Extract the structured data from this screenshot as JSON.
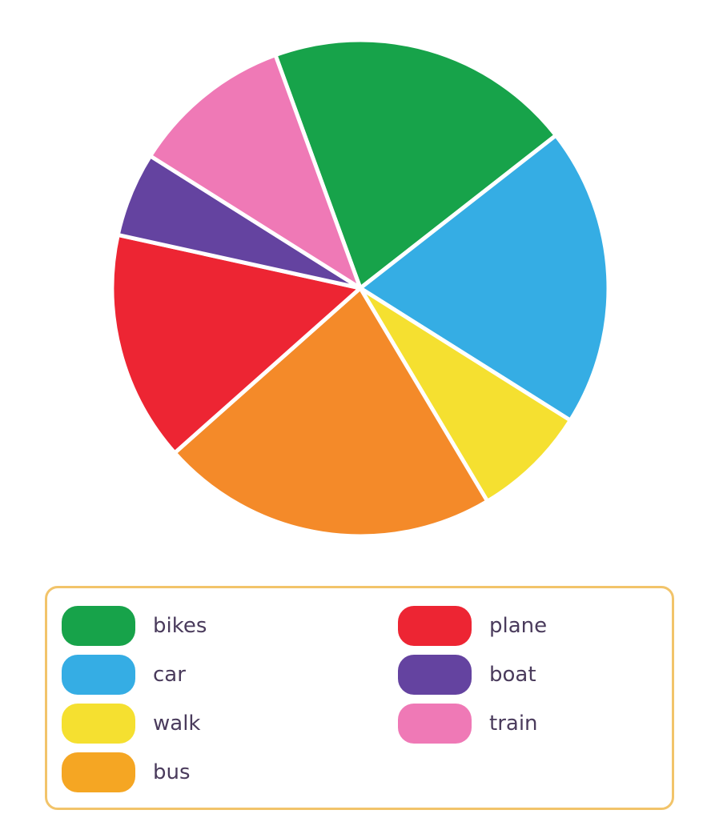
{
  "chart_data": {
    "type": "pie",
    "title": "",
    "categories": [
      "bikes",
      "car",
      "walk",
      "bus",
      "plane",
      "boat",
      "train"
    ],
    "values": [
      20,
      19.5,
      7.5,
      22,
      15,
      5.5,
      10.5
    ],
    "colors": [
      "#17a34a",
      "#35ade4",
      "#f5e030",
      "#f48a29",
      "#ed2533",
      "#6443a0",
      "#ef79b6"
    ],
    "legend_position": "bottom",
    "legend": [
      {
        "label": "bikes",
        "color": "#17a34a"
      },
      {
        "label": "car",
        "color": "#35ade4"
      },
      {
        "label": "walk",
        "color": "#f5e030"
      },
      {
        "label": "bus",
        "color": "#f5a623"
      },
      {
        "label": "plane",
        "color": "#ed2533"
      },
      {
        "label": "boat",
        "color": "#6443a0"
      },
      {
        "label": "train",
        "color": "#ef79b6"
      }
    ]
  }
}
